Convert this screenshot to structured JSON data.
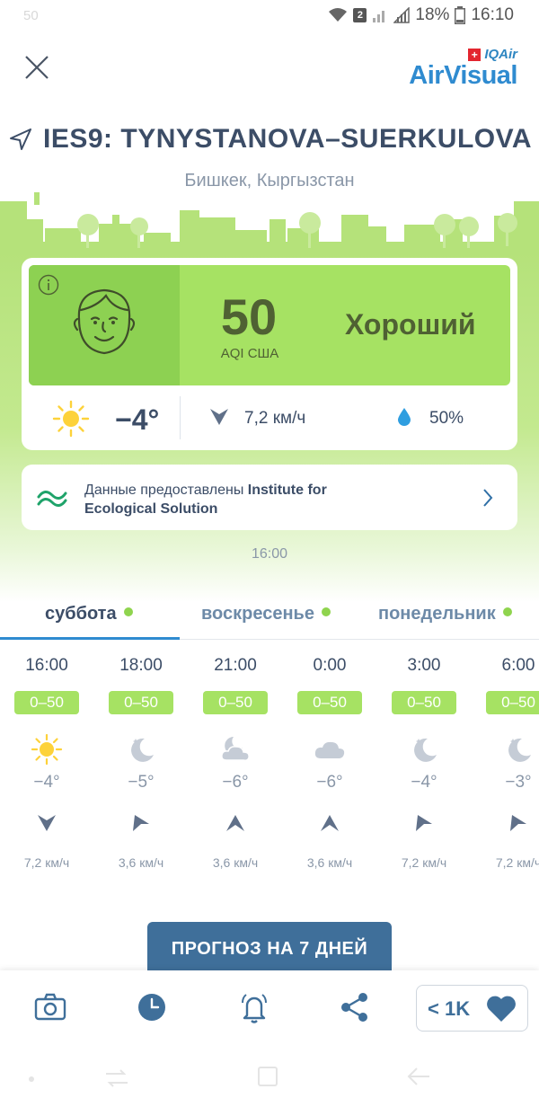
{
  "status_bar": {
    "left_text": "50",
    "sim_badge": "2",
    "battery": "18%",
    "time": "16:10"
  },
  "header": {
    "brand_top": "IQAir",
    "brand_name": "AirVisual"
  },
  "station": {
    "name": "IES9: TYNYSTANOVA–SUERKULOVA",
    "location": "Бишкек, Кыргызстан"
  },
  "aqi": {
    "value": "50",
    "unit": "AQI США",
    "label": "Хороший",
    "panel_color": "#a6e263"
  },
  "weather": {
    "temperature": "−4°",
    "wind": "7,2 км/ч",
    "humidity": "50%"
  },
  "source": {
    "prefix": "Данные предоставлены ",
    "provider_line1": "Institute for",
    "provider_line2": "Ecological Solution"
  },
  "update_time": "16:00",
  "tabs": [
    {
      "label": "суббота"
    },
    {
      "label": "воскресенье"
    },
    {
      "label": "понедельник"
    }
  ],
  "hourly": [
    {
      "time": "16:00",
      "aqi": "0–50",
      "icon": "sun-icon",
      "temp": "−4°",
      "wind": "7,2 км/ч"
    },
    {
      "time": "18:00",
      "aqi": "0–50",
      "icon": "moon-icon",
      "temp": "−5°",
      "wind": "3,6 км/ч"
    },
    {
      "time": "21:00",
      "aqi": "0–50",
      "icon": "cloud-moon-icon",
      "temp": "−6°",
      "wind": "3,6 км/ч"
    },
    {
      "time": "0:00",
      "aqi": "0–50",
      "icon": "cloud-icon",
      "temp": "−6°",
      "wind": "3,6 км/ч"
    },
    {
      "time": "3:00",
      "aqi": "0–50",
      "icon": "moon-icon",
      "temp": "−4°",
      "wind": "7,2 км/ч"
    },
    {
      "time": "6:00",
      "aqi": "0–50",
      "icon": "moon-icon",
      "temp": "−3°",
      "wind": "7,2 км/ч"
    }
  ],
  "forecast_button": "ПРОГНОЗ НА 7 ДНЕЙ",
  "bottom_bar": {
    "like_count": "< 1K"
  },
  "colors": {
    "accent": "#2f8bd0",
    "good_green": "#a6e263",
    "button": "#3f6f9a"
  }
}
